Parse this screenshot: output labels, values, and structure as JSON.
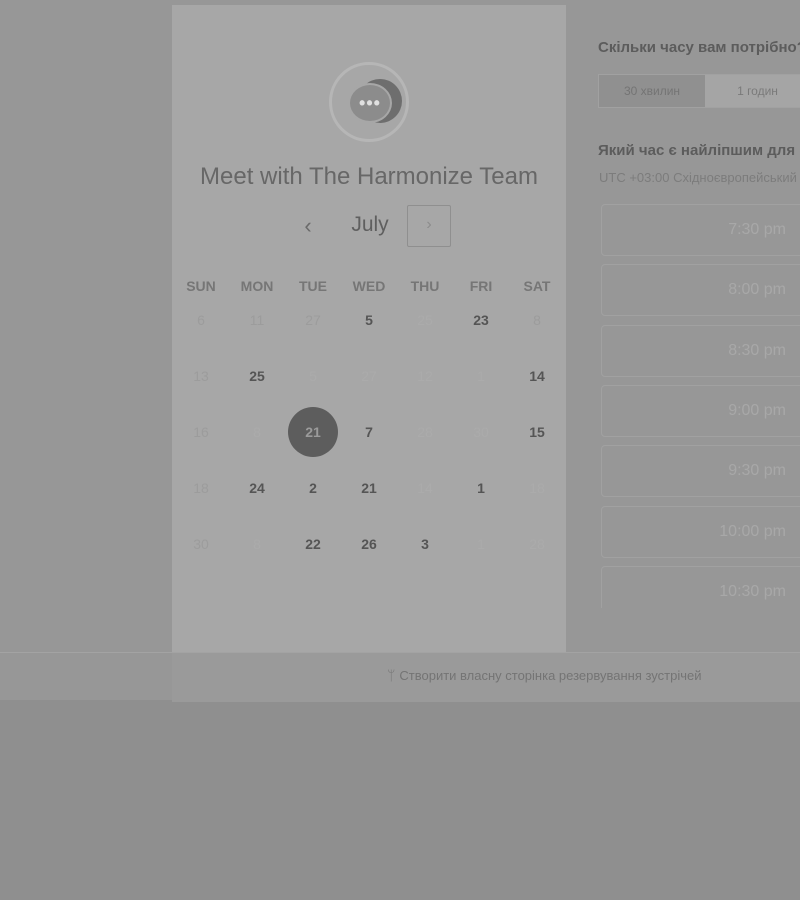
{
  "calendar": {
    "title": "Meet with The Harmonize Team",
    "logo_icon": "chat-bubble-icon",
    "logo_dots": "•••",
    "month": "July",
    "prev_icon": "‹",
    "next_icon": "›",
    "weekdays": [
      "SUN",
      "MON",
      "TUE",
      "WED",
      "THU",
      "FRI",
      "SAT"
    ],
    "weeks": [
      [
        {
          "d": "6",
          "s": "dim"
        },
        {
          "d": "11",
          "s": "dim"
        },
        {
          "d": "27",
          "s": "dim"
        },
        {
          "d": "5",
          "s": "avail"
        },
        {
          "d": "25",
          "s": "muted"
        },
        {
          "d": "23",
          "s": "avail"
        },
        {
          "d": "8",
          "s": "dim"
        }
      ],
      [
        {
          "d": "13",
          "s": "dim"
        },
        {
          "d": "25",
          "s": "avail"
        },
        {
          "d": "5",
          "s": "muted"
        },
        {
          "d": "27",
          "s": "muted"
        },
        {
          "d": "12",
          "s": "muted"
        },
        {
          "d": "1",
          "s": "muted"
        },
        {
          "d": "14",
          "s": "avail"
        }
      ],
      [
        {
          "d": "16",
          "s": "dim"
        },
        {
          "d": "8",
          "s": "muted"
        },
        {
          "d": "21",
          "s": "selected"
        },
        {
          "d": "7",
          "s": "avail"
        },
        {
          "d": "28",
          "s": "muted"
        },
        {
          "d": "30",
          "s": "muted"
        },
        {
          "d": "15",
          "s": "avail"
        }
      ],
      [
        {
          "d": "18",
          "s": "dim"
        },
        {
          "d": "24",
          "s": "avail"
        },
        {
          "d": "2",
          "s": "avail"
        },
        {
          "d": "21",
          "s": "avail"
        },
        {
          "d": "14",
          "s": "muted"
        },
        {
          "d": "1",
          "s": "avail"
        },
        {
          "d": "18",
          "s": "muted"
        }
      ],
      [
        {
          "d": "30",
          "s": "dim"
        },
        {
          "d": "8",
          "s": "muted"
        },
        {
          "d": "22",
          "s": "avail"
        },
        {
          "d": "26",
          "s": "avail"
        },
        {
          "d": "3",
          "s": "avail"
        },
        {
          "d": "1",
          "s": "muted"
        },
        {
          "d": "28",
          "s": "muted"
        }
      ]
    ]
  },
  "duration": {
    "question": "Скільки часу вам потрібно?",
    "options": [
      "30 хвилин",
      "1 годин"
    ],
    "selected": 0
  },
  "times": {
    "question": "Який час є найліпшим для вас?",
    "timezone": "UTC +03:00 Східноєвропейський",
    "slots": [
      "7:30 pm",
      "8:00 pm",
      "8:30 pm",
      "9:00 pm",
      "9:30 pm",
      "10:00 pm",
      "10:30 pm"
    ]
  },
  "footer": {
    "icon": "hubspot-sprocket-icon",
    "icon_glyph": "ᛘ",
    "link": "Створити власну сторінка резервування зустрічей"
  }
}
